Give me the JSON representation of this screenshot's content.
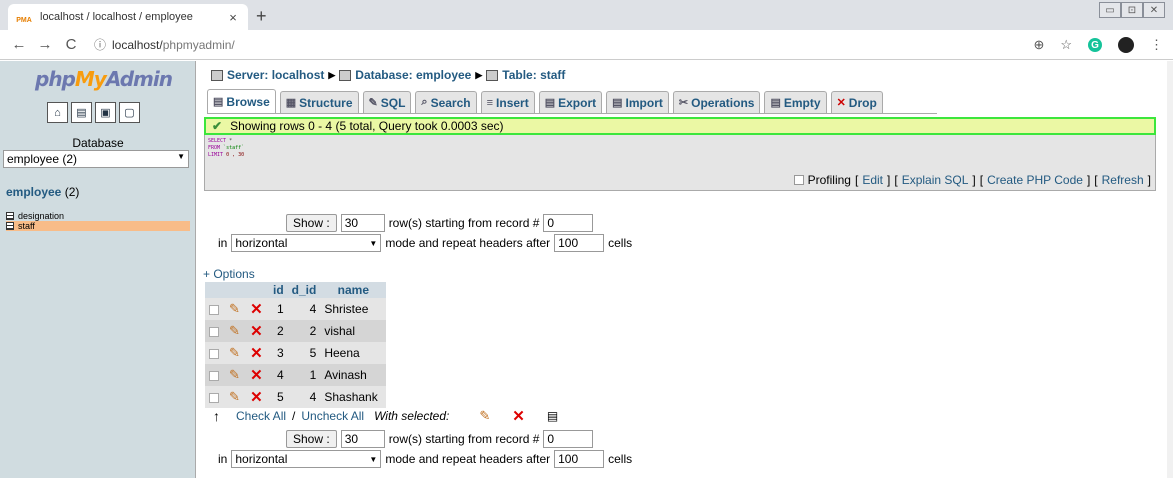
{
  "browser": {
    "tab_title": "localhost / localhost / employee",
    "tab_favicon": "PMA",
    "tab_close": "×",
    "new_tab": "+",
    "url_host": "localhost/",
    "url_path": "phpmyadmin/",
    "nav": {
      "back": "←",
      "forward": "→",
      "reload": "C"
    },
    "icons": {
      "zoom": "⊕",
      "star": "☆",
      "ext": "G"
    },
    "window": {
      "min": "▭",
      "max": "⊡",
      "close": "✕"
    }
  },
  "left": {
    "logo_php": "php",
    "logo_my": "My",
    "logo_admin": "Admin",
    "database_label": "Database",
    "db_selected": "employee (2)",
    "db_name": "employee",
    "db_count": " (2)",
    "tables": [
      {
        "name": "designation"
      },
      {
        "name": "staff"
      }
    ]
  },
  "breadcrumb": {
    "server": "Server: localhost",
    "database": "Database: employee",
    "table": "Table: staff"
  },
  "tabs": {
    "browse": "Browse",
    "structure": "Structure",
    "sql": "SQL",
    "search": "Search",
    "insert": "Insert",
    "export": "Export",
    "import": "Import",
    "operations": "Operations",
    "empty": "Empty",
    "drop": "Drop"
  },
  "message": {
    "success": "Showing rows 0 - 4 (5 total, Query took 0.0003 sec)"
  },
  "sql": {
    "line1_kw": "SELECT",
    "line1_rest": " *",
    "line2_kw": "FROM",
    "line2_str": " `staff`",
    "line3_kw": "LIMIT",
    "line3_num": " 0 , 30"
  },
  "sql_links": {
    "profiling": "Profiling",
    "open": "[",
    "close": "]",
    "edit": "Edit",
    "explain": "Explain SQL",
    "php": "Create PHP Code",
    "refresh": "Refresh"
  },
  "nav_form": {
    "show_button": "Show :",
    "rows_value": "30",
    "rows_text": "row(s) starting from record #",
    "start_value": "0",
    "in_text": "in",
    "mode_value": "horizontal",
    "mode_text": "mode and repeat headers after",
    "repeat_value": "100",
    "cells_text": "cells"
  },
  "options_link": "+ Options",
  "table": {
    "columns": [
      "id",
      "d_id",
      "name"
    ],
    "rows": [
      {
        "id": "1",
        "d_id": "4",
        "name": "Shristee"
      },
      {
        "id": "2",
        "d_id": "2",
        "name": "vishal"
      },
      {
        "id": "3",
        "d_id": "5",
        "name": "Heena"
      },
      {
        "id": "4",
        "d_id": "1",
        "name": "Avinash"
      },
      {
        "id": "5",
        "d_id": "4",
        "name": "Shashank"
      }
    ]
  },
  "bulk": {
    "check_all": "Check All",
    "slash": "/",
    "uncheck_all": "Uncheck All",
    "with_selected": "With selected:"
  }
}
